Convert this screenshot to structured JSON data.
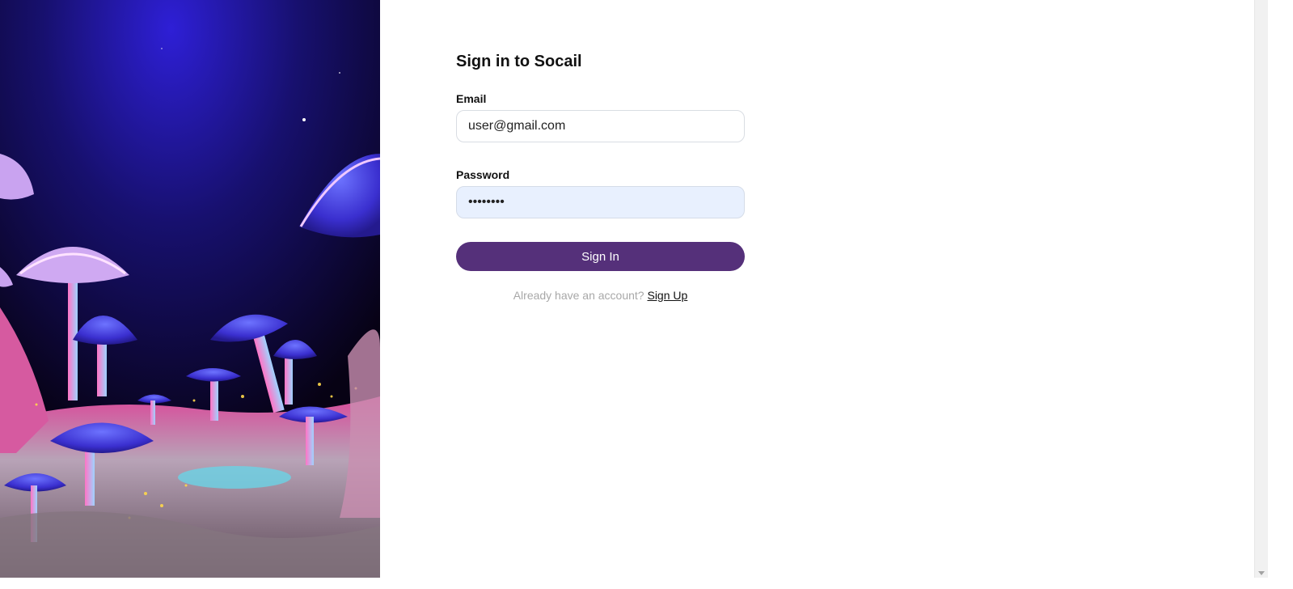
{
  "hero": {
    "icon": "mushroom-landscape-image"
  },
  "signin": {
    "title": "Sign in to Socail",
    "email_label": "Email",
    "email_value": "user@gmail.com",
    "password_label": "Password",
    "password_value": "••••••••",
    "button_label": "Sign In",
    "account_text": "Already have an account?",
    "signup_link": "Sign Up"
  },
  "colors": {
    "button": "#55307a",
    "autofill": "#e8f0fe",
    "muted_text": "#a8a8a8"
  }
}
